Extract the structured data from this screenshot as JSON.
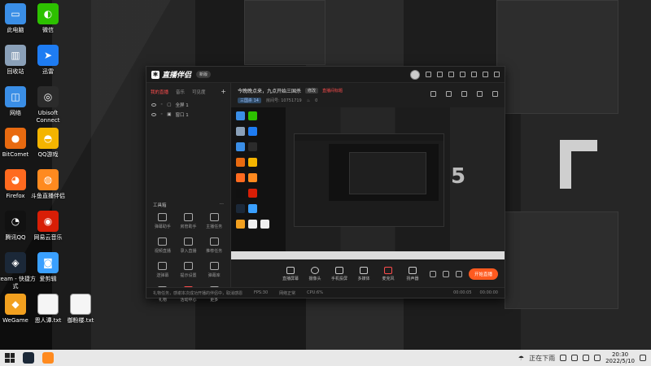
{
  "desktop": {
    "icons": [
      {
        "label": "此电脑",
        "color": "#3a8ee6",
        "glyph": "▭"
      },
      {
        "label": "微信",
        "color": "#2dc100",
        "glyph": "◐"
      },
      {
        "label": "回收站",
        "color": "#8aa0b8",
        "glyph": "▥"
      },
      {
        "label": "迅雷",
        "color": "#1e7cf2",
        "glyph": "➤"
      },
      {
        "label": "网络",
        "color": "#3a8ee6",
        "glyph": "◫"
      },
      {
        "label": "Ubisoft Connect",
        "color": "#2b2b2b",
        "glyph": "◎"
      },
      {
        "label": "BitComet",
        "color": "#e86a10",
        "glyph": "●"
      },
      {
        "label": "QQ游戏",
        "color": "#f4b400",
        "glyph": "◓"
      },
      {
        "label": "Firefox",
        "color": "#ff6a1f",
        "glyph": "◕"
      },
      {
        "label": "斗鱼直播伴侣",
        "color": "#ff8a1f",
        "glyph": "◍"
      },
      {
        "label": "腾讯QQ",
        "color": "#111111",
        "glyph": "◔"
      },
      {
        "label": "网易云音乐",
        "color": "#d81e06",
        "glyph": "◉"
      },
      {
        "label": "steam - 快捷方式",
        "color": "#1b2838",
        "glyph": "◈"
      },
      {
        "label": "爱剪辑",
        "color": "#3aa0ff",
        "glyph": "◙"
      },
      {
        "label": "WeGame",
        "color": "#f2a01f",
        "glyph": "◆"
      },
      {
        "label": "恩人谭.txt",
        "color": "#f5f5f5",
        "glyph": ""
      },
      {
        "label": "御粉楼.txt",
        "color": "#f5f5f5",
        "glyph": ""
      }
    ]
  },
  "app": {
    "logo": "直播伴侣",
    "version": "新版",
    "tabs": [
      "我的直播",
      "音乐",
      "可见度"
    ],
    "sources": [
      {
        "label": "全屏 1"
      },
      {
        "label": "窗口 1"
      }
    ],
    "tools_title": "工具箱",
    "tools": [
      {
        "label": "弹幕助手"
      },
      {
        "label": "房管助手"
      },
      {
        "label": "主播任务"
      },
      {
        "label": "视频直播"
      },
      {
        "label": "录入直播"
      },
      {
        "label": "推荐任务"
      },
      {
        "label": "送弹幕"
      },
      {
        "label": "提示设置"
      },
      {
        "label": "弹幕库"
      },
      {
        "label": "礼物"
      },
      {
        "label": "活动中心"
      },
      {
        "label": "更多"
      }
    ],
    "stream_title": "今晚晚点来，九点开始三国杀",
    "title_badge": "修改",
    "title_warn": "直播间标题",
    "category": "三国杀 14",
    "room_id": "房间号: 10751719",
    "hot_count": "0",
    "controls": [
      {
        "label": "直播屏幕",
        "icon": "screen-icon"
      },
      {
        "label": "摄像头",
        "icon": "camera-icon"
      },
      {
        "label": "手机投屏",
        "icon": "phone-icon"
      },
      {
        "label": "多媒体",
        "icon": "media-icon"
      },
      {
        "label": "麦克风",
        "icon": "mic-icon"
      },
      {
        "label": "扬声器",
        "icon": "speaker-icon"
      }
    ],
    "start_button": "开始直播",
    "status_left": "礼物任务，感谢本次成功开播的伴侣中，取消感恩",
    "status_fps": "FPS:30",
    "status_net": "网络正常",
    "status_cpu": "CPU:6%",
    "status_time1": "00:00:05",
    "status_time2": "00:00:00"
  },
  "taskbar": {
    "weather": "正在下雨",
    "time": "20:30",
    "date": "2022/5/10"
  }
}
